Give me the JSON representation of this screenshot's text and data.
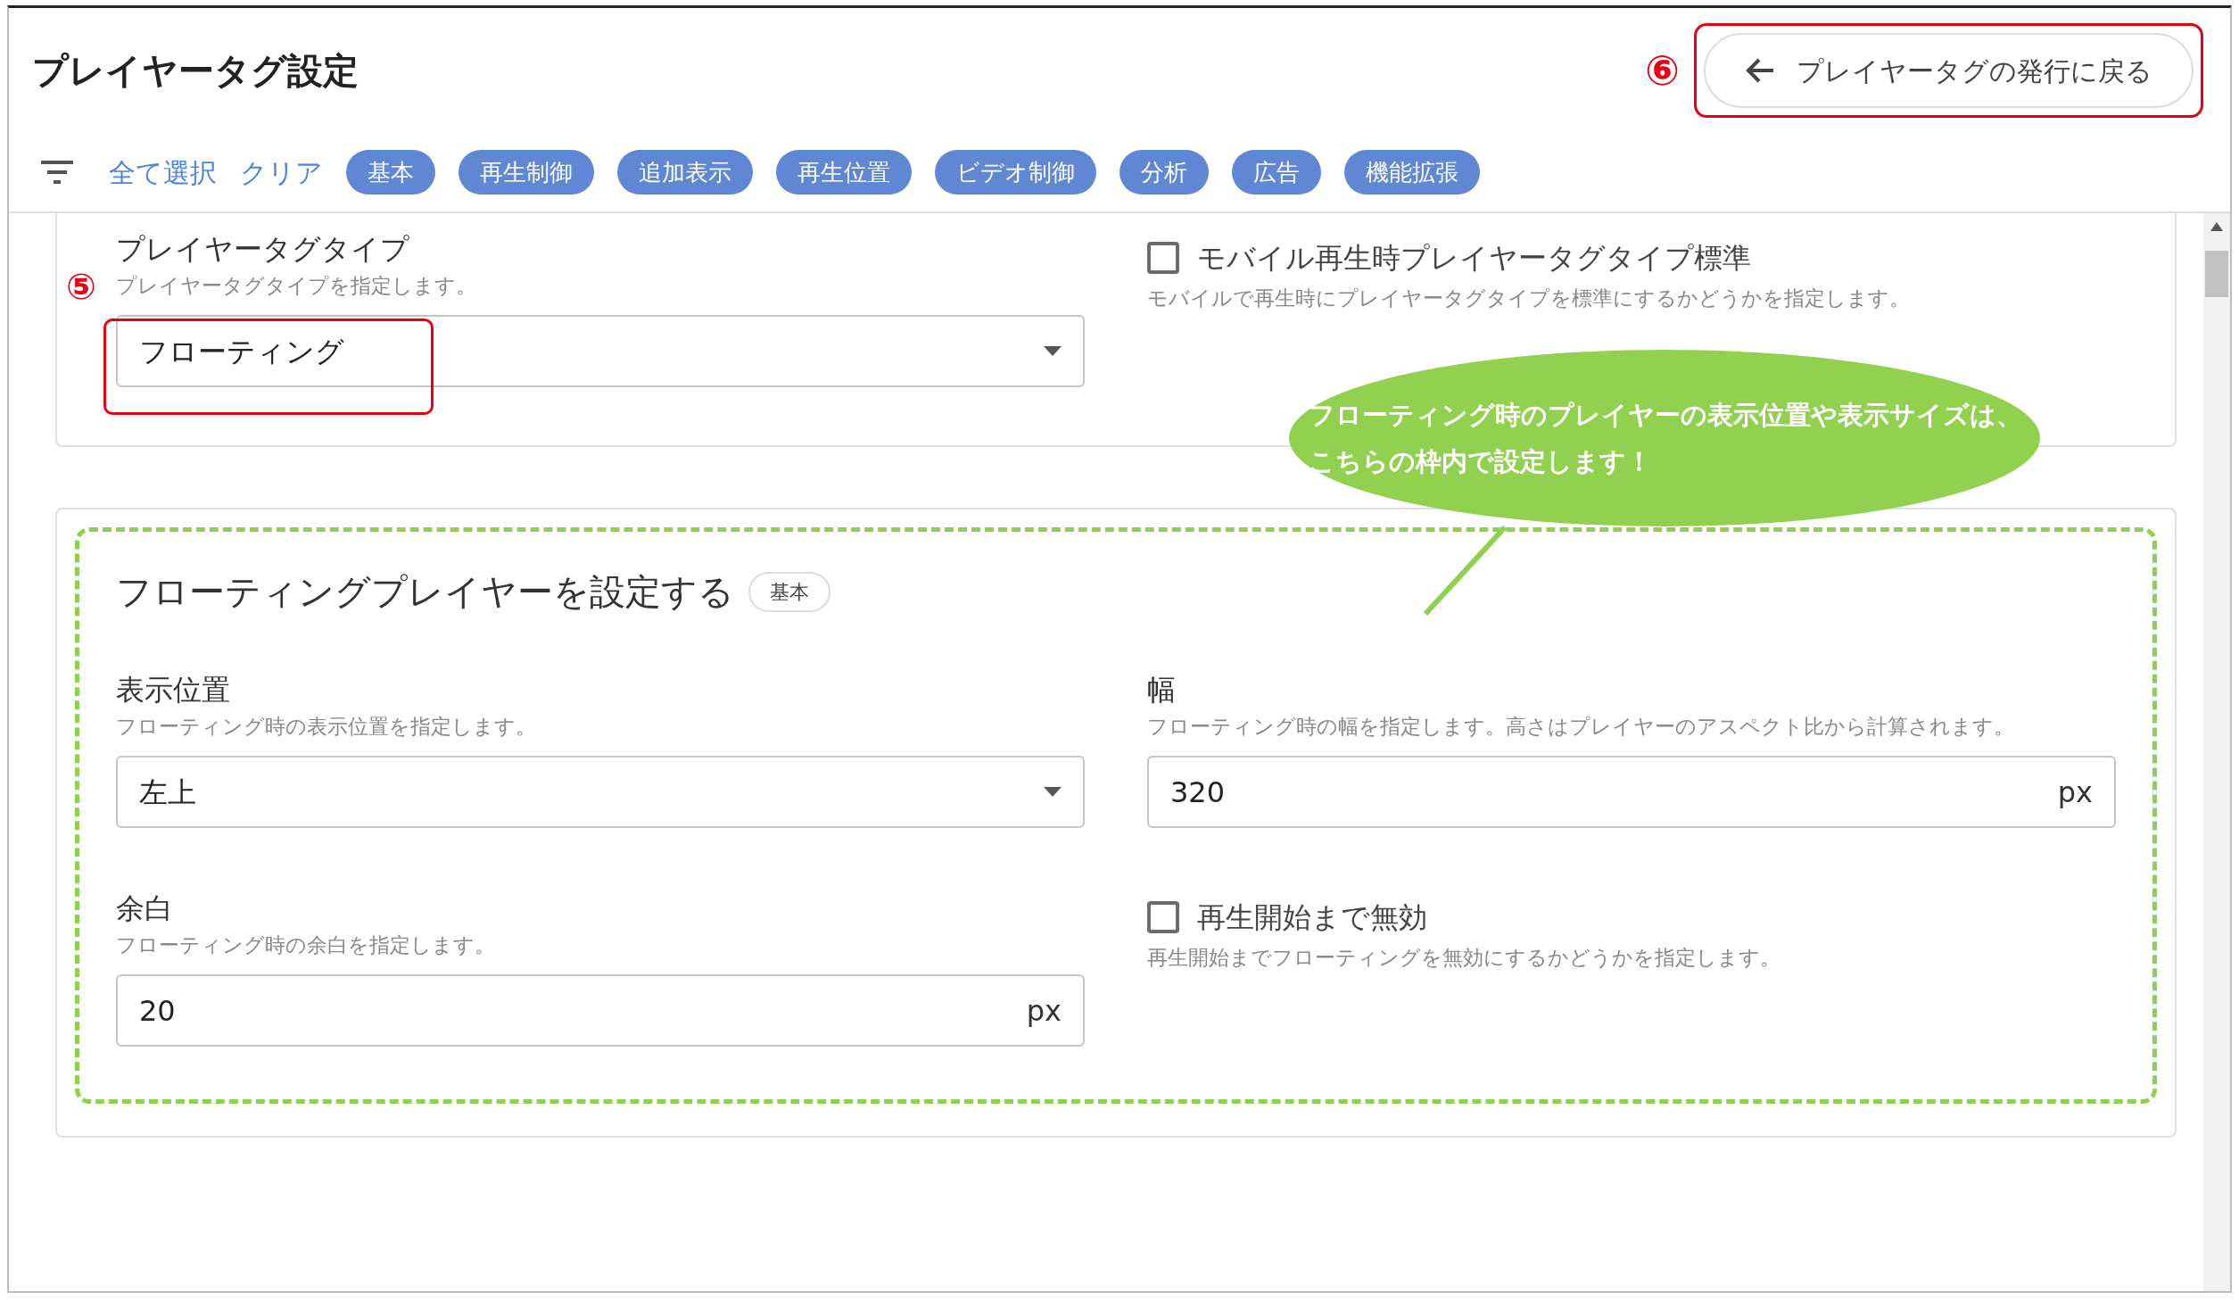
{
  "page": {
    "title": "プレイヤータグ設定"
  },
  "back_button": {
    "label": "プレイヤータグの発行に戻る"
  },
  "filter_bar": {
    "select_all": "全て選択",
    "clear": "クリア",
    "chips": [
      "基本",
      "再生制御",
      "追加表示",
      "再生位置",
      "ビデオ制御",
      "分析",
      "広告",
      "機能拡張"
    ]
  },
  "sections": [
    {
      "fields": [
        {
          "kind": "select",
          "label": "プレイヤータグタイプ",
          "hint": "プレイヤータグタイプを指定します。",
          "value": "フローティング"
        },
        {
          "kind": "checkbox",
          "label": "モバイル再生時プレイヤータグタイプ標準",
          "hint": "モバイルで再生時にプレイヤータグタイプを標準にするかどうかを指定します。",
          "checked": false
        }
      ]
    },
    {
      "title": "フローティングプレイヤーを設定する",
      "badge": "基本",
      "fields": [
        {
          "kind": "select",
          "label": "表示位置",
          "hint": "フローティング時の表示位置を指定します。",
          "value": "左上"
        },
        {
          "kind": "number",
          "label": "幅",
          "hint": "フローティング時の幅を指定します。高さはプレイヤーのアスペクト比から計算されます。",
          "value": "320",
          "unit": "px"
        },
        {
          "kind": "number",
          "label": "余白",
          "hint": "フローティング時の余白を指定します。",
          "value": "20",
          "unit": "px"
        },
        {
          "kind": "checkbox",
          "label": "再生開始まで無効",
          "hint": "再生開始までフローティングを無効にするかどうかを指定します。",
          "checked": false
        }
      ]
    }
  ],
  "annotations": {
    "marker_select": "⑤",
    "marker_back": "⑥",
    "callout": [
      "フローティング時のプレイヤーの表示位置や表示サイズは、",
      "こちらの枠内で設定します！"
    ]
  }
}
